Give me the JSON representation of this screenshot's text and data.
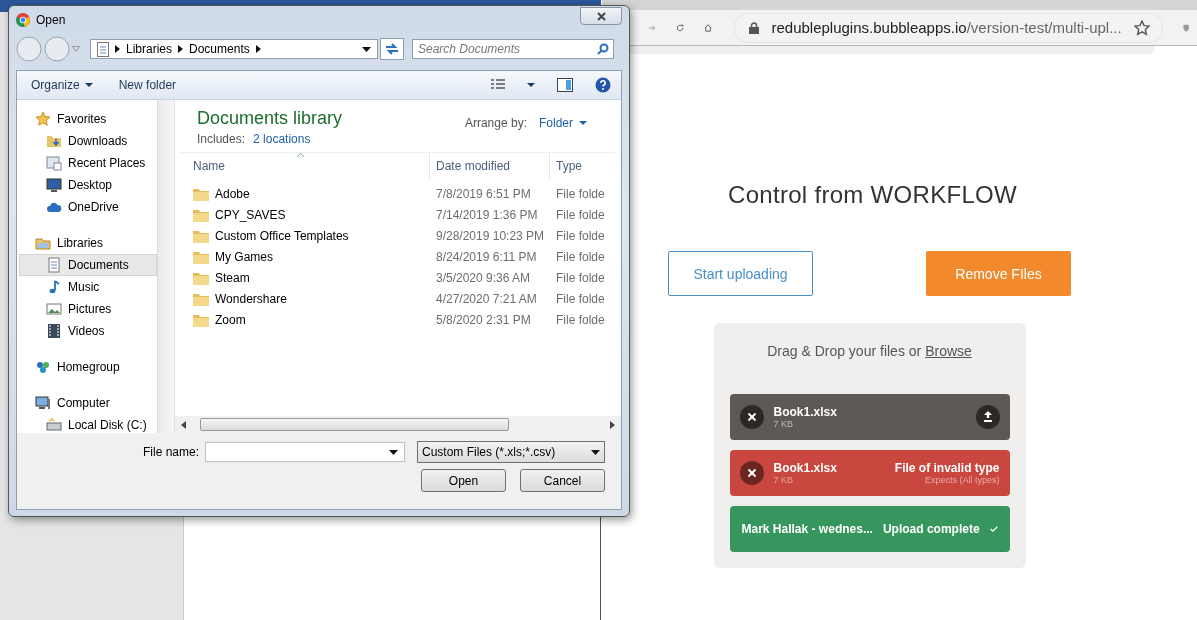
{
  "browser": {
    "url_host": "redubleplugins.bubbleapps.io",
    "url_path": "/version-test/multi-upl..."
  },
  "page": {
    "heading": "Control from WORKFLOW",
    "buttons": [
      {
        "label": "Start uploading",
        "kind": "outline"
      },
      {
        "label": "Remove FIles",
        "kind": "filled"
      }
    ],
    "dropzone": {
      "prompt": "Drag & Drop your files or ",
      "link": "Browse",
      "files": [
        {
          "kind": "pending",
          "name": "Book1.xlsx",
          "size": "7 KB"
        },
        {
          "kind": "error",
          "name": "Book1.xlsx",
          "size": "7 KB",
          "message": "File of invalid type",
          "detail": "Expects (All types)"
        },
        {
          "kind": "complete",
          "name": "Mark Hallak - wednes...",
          "message": "Upload complete"
        }
      ]
    }
  },
  "dialog": {
    "title": "Open",
    "breadcrumb": [
      "Libraries",
      "Documents"
    ],
    "search": {
      "placeholder": "Search Documents"
    },
    "toolbar": {
      "organize": "Organize",
      "new_folder": "New folder"
    },
    "nav": [
      {
        "label": "Favorites",
        "kind": "star",
        "selected": false,
        "children": [
          {
            "label": "Downloads",
            "kind": "download",
            "selected": false
          },
          {
            "label": "Recent Places",
            "kind": "recent",
            "selected": false
          },
          {
            "label": "Desktop",
            "kind": "desktop",
            "selected": false
          },
          {
            "label": "OneDrive",
            "kind": "cloud",
            "selected": false
          }
        ]
      },
      {
        "label": "Libraries",
        "kind": "library",
        "selected": false,
        "children": [
          {
            "label": "Documents",
            "kind": "document",
            "selected": true
          },
          {
            "label": "Music",
            "kind": "music",
            "selected": false
          },
          {
            "label": "Pictures",
            "kind": "picture",
            "selected": false
          },
          {
            "label": "Videos",
            "kind": "video",
            "selected": false
          }
        ]
      },
      {
        "label": "Homegroup",
        "kind": "homegroup",
        "selected": false
      },
      {
        "label": "Computer",
        "kind": "computer",
        "selected": false,
        "children": [
          {
            "label": "Local Disk (C:)",
            "kind": "disk",
            "selected": false
          }
        ]
      }
    ],
    "library": {
      "title": "Documents library",
      "includes_label": "Includes:",
      "includes_link": "2 locations",
      "arrange_label": "Arrange by:",
      "arrange_value": "Folder"
    },
    "columns": [
      "Name",
      "Date modified",
      "Type"
    ],
    "rows": [
      {
        "name": "Adobe",
        "date": "7/8/2019 6:51 PM",
        "type": "File folde"
      },
      {
        "name": "CPY_SAVES",
        "date": "7/14/2019 1:36 PM",
        "type": "File folde"
      },
      {
        "name": "Custom Office Templates",
        "date": "9/28/2019 10:23 PM",
        "type": "File folde"
      },
      {
        "name": "My Games",
        "date": "8/24/2019 6:11 PM",
        "type": "File folde"
      },
      {
        "name": "Steam",
        "date": "3/5/2020 9:36 AM",
        "type": "File folde"
      },
      {
        "name": "Wondershare",
        "date": "4/27/2020 7:21 AM",
        "type": "File folde"
      },
      {
        "name": "Zoom",
        "date": "5/8/2020 2:31 PM",
        "type": "File folde"
      }
    ],
    "file_name_label": "File name:",
    "filter": "Custom Files (*.xls;*.csv)",
    "open_button": "Open",
    "cancel_button": "Cancel"
  }
}
